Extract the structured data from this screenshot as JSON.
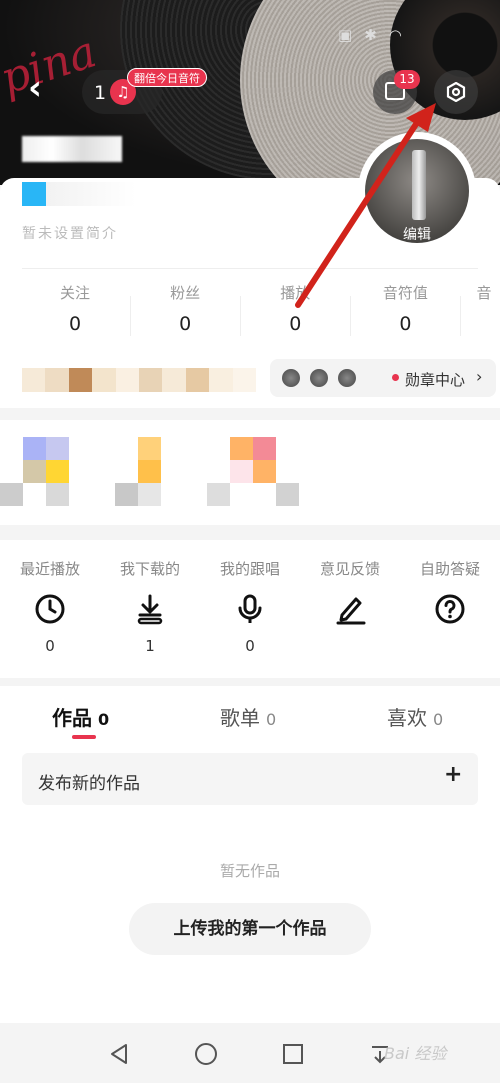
{
  "header": {
    "level_number": "1",
    "double_badge": "翻倍今日音符",
    "message_count": "13"
  },
  "profile": {
    "intro_placeholder": "暂未设置简介",
    "edit_label": "编辑"
  },
  "stats": [
    {
      "label": "关注",
      "value": "0"
    },
    {
      "label": "粉丝",
      "value": "0"
    },
    {
      "label": "播放",
      "value": "0"
    },
    {
      "label": "音符值",
      "value": "0"
    },
    {
      "label": "音"
    }
  ],
  "medals": {
    "label": "勋章中心"
  },
  "functions": [
    {
      "label": "最近播放",
      "icon": "clock-icon",
      "count": "0"
    },
    {
      "label": "我下载的",
      "icon": "download-icon",
      "count": "1"
    },
    {
      "label": "我的跟唱",
      "icon": "microphone-icon",
      "count": "0"
    },
    {
      "label": "意见反馈",
      "icon": "pen-icon",
      "count": ""
    },
    {
      "label": "自助答疑",
      "icon": "help-icon",
      "count": ""
    }
  ],
  "tabs": [
    {
      "label": "作品",
      "count": "0",
      "active": true
    },
    {
      "label": "歌单",
      "count": "0"
    },
    {
      "label": "喜欢",
      "count": "0"
    }
  ],
  "works": {
    "publish_label": "发布新的作品",
    "empty_text": "暂无作品",
    "upload_button": "上传我的第一个作品"
  },
  "watermark": "Bai 经验",
  "colors": {
    "accent": "#e8344e",
    "annotation_arrow": "#d1231b"
  }
}
